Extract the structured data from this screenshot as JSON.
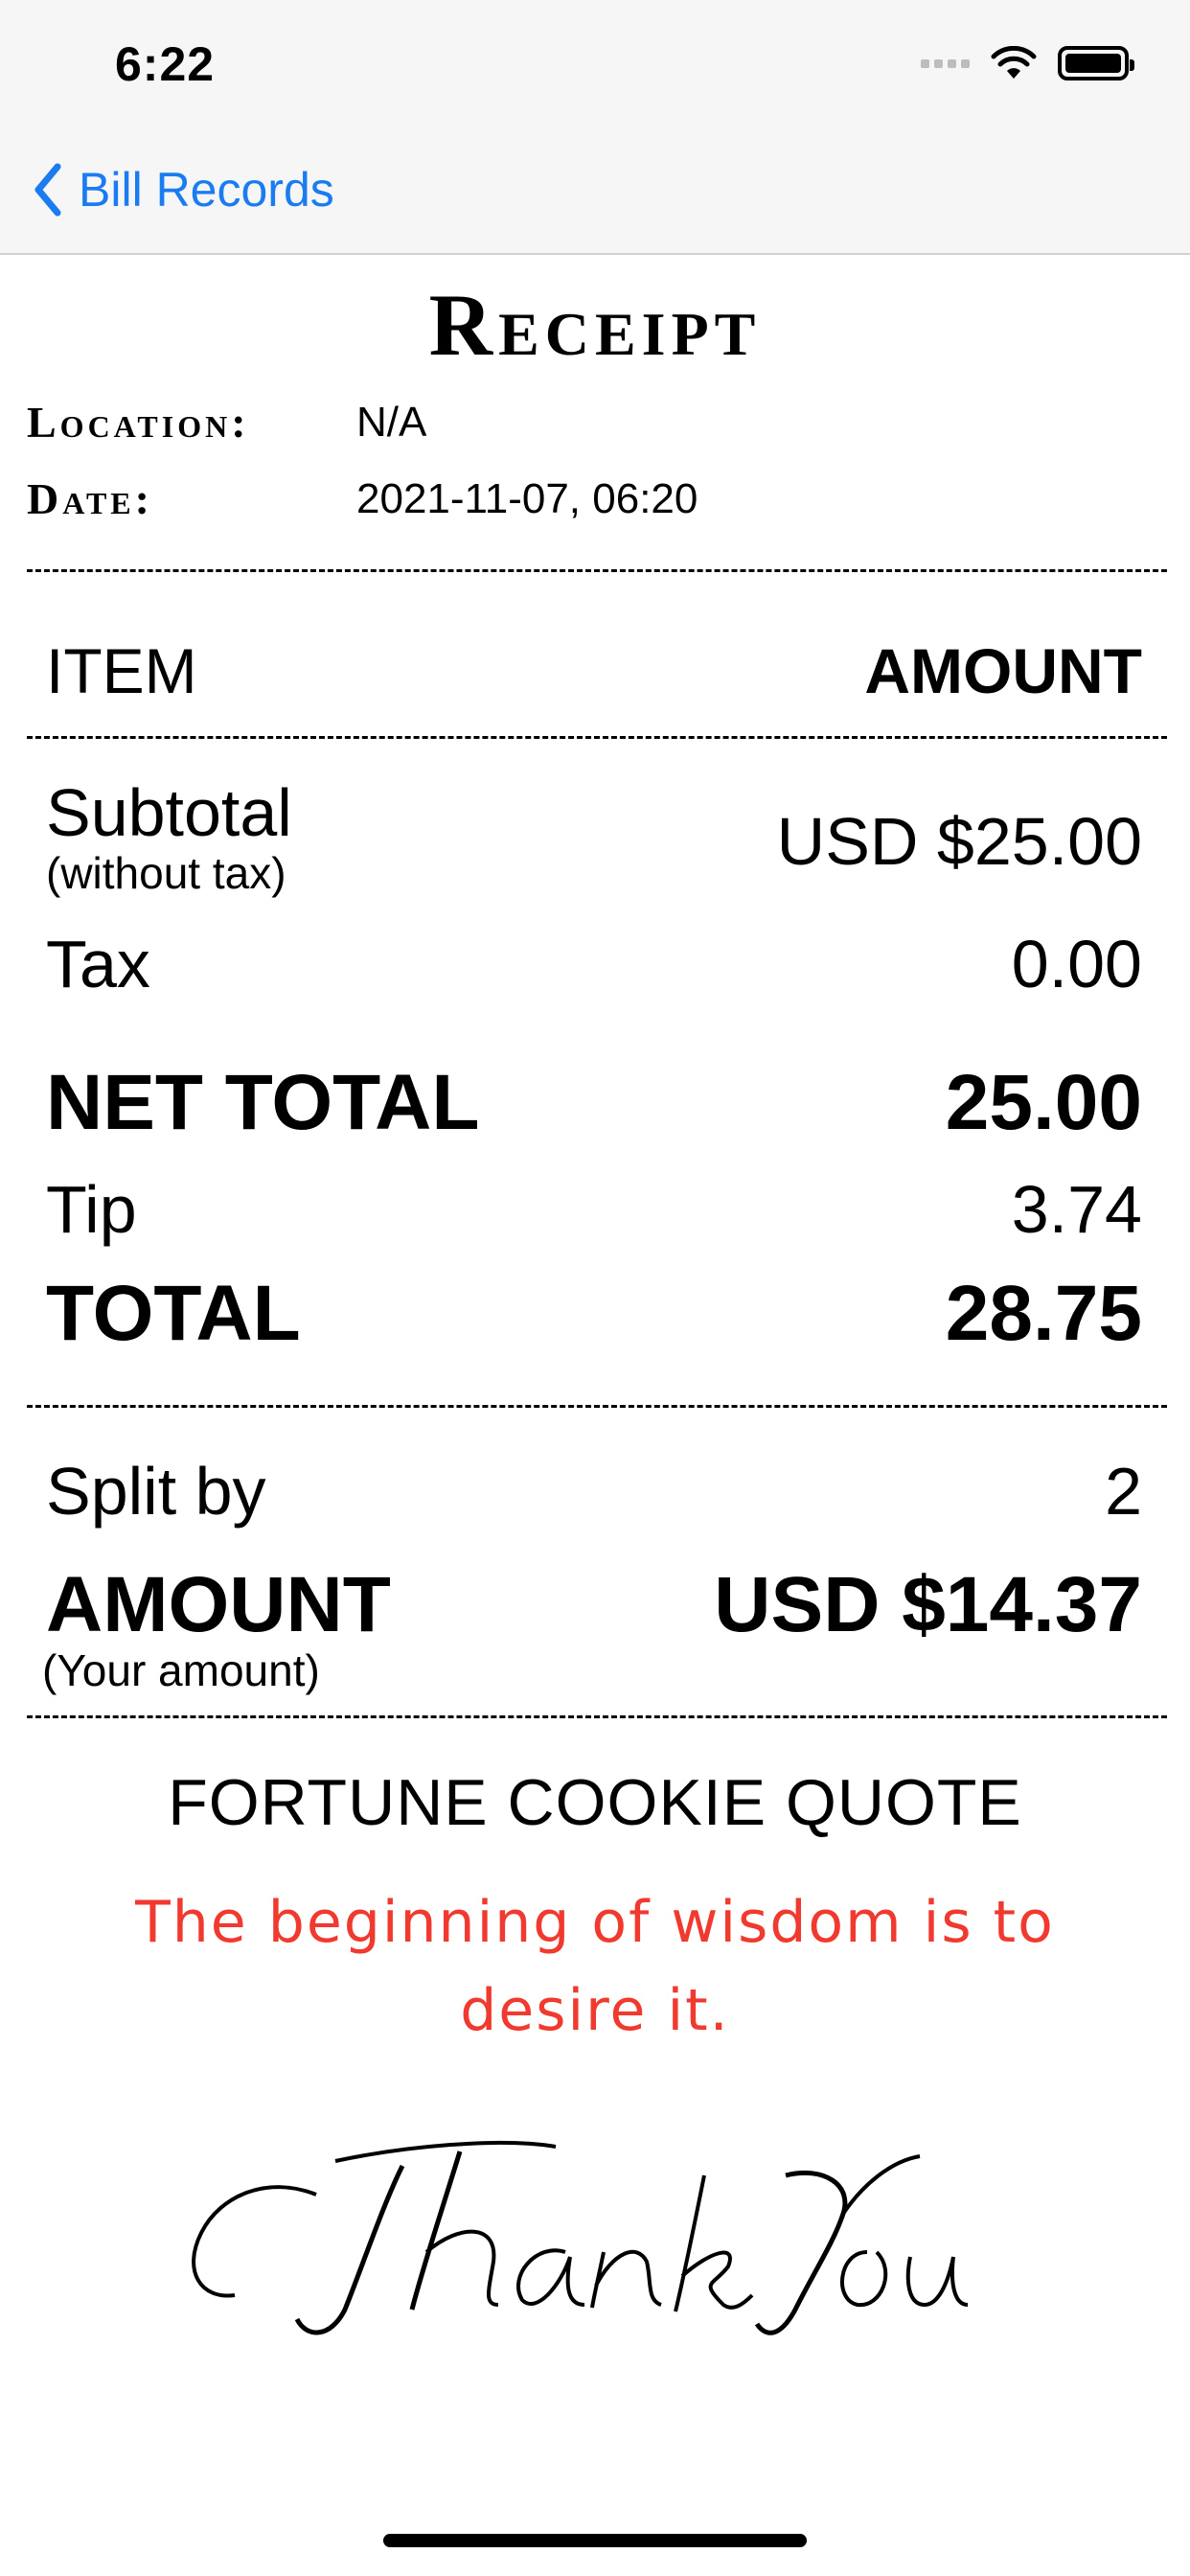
{
  "status_bar": {
    "time": "6:22"
  },
  "nav": {
    "back_label": "Bill Records"
  },
  "receipt": {
    "title": "Receipt",
    "location_label": "Location:",
    "location_value": "N/A",
    "date_label": "Date:",
    "date_value": "2021-11-07, 06:20",
    "header_item": "ITEM",
    "header_amount": "AMOUNT",
    "subtotal_label": "Subtotal",
    "subtotal_note": "(without tax)",
    "subtotal_value": "USD $25.00",
    "tax_label": "Tax",
    "tax_value": "0.00",
    "net_total_label": "NET TOTAL",
    "net_total_value": "25.00",
    "tip_label": "Tip",
    "tip_value": "3.74",
    "total_label": "TOTAL",
    "total_value": "28.75",
    "split_label": "Split by",
    "split_value": "2",
    "amount_label": "AMOUNT",
    "amount_note": "(Your amount)",
    "amount_value": "USD $14.37"
  },
  "fortune": {
    "heading": "FORTUNE COOKIE QUOTE",
    "quote": "The beginning of wisdom is to desire it."
  },
  "signature": {
    "text": "Thank You"
  },
  "colors": {
    "accent_blue": "#1a7cf0",
    "quote_red": "#f0392f"
  }
}
